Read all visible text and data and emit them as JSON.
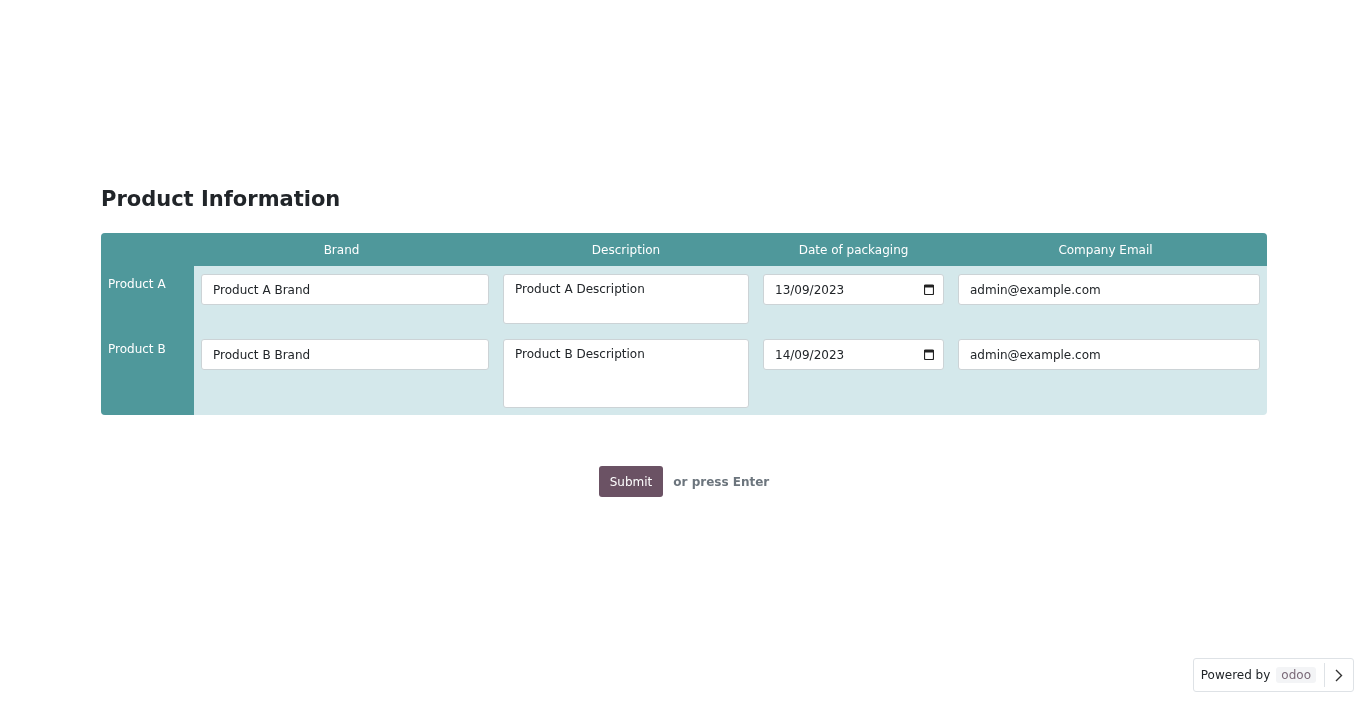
{
  "title": "Product Information",
  "columns": [
    "Brand",
    "Description",
    "Date of packaging",
    "Company Email"
  ],
  "rows": [
    {
      "label": "Product A",
      "brand": "Product A Brand",
      "description": "Product A Description",
      "date": "13/09/2023",
      "email": "admin@example.com"
    },
    {
      "label": "Product B",
      "brand": "Product B Brand",
      "description": "Product B Description",
      "date": "14/09/2023",
      "email": "admin@example.com"
    }
  ],
  "submit": {
    "label": "Submit",
    "hint": "or press Enter"
  },
  "footer": {
    "text": "Powered by",
    "logo": "odoo"
  }
}
